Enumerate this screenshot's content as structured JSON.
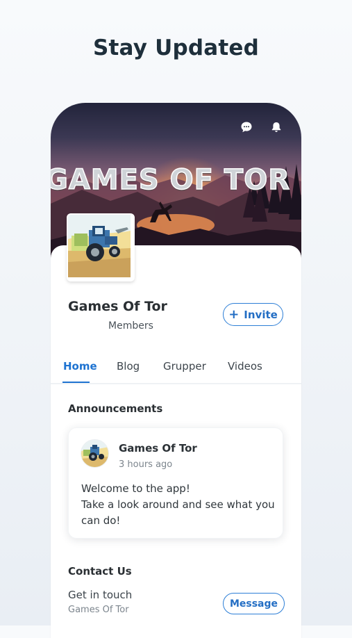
{
  "promo": {
    "headline": "Stay Updated"
  },
  "group": {
    "cover_title": "GAMES OF TOR",
    "name": "Games Of Tor",
    "members_label": "Members",
    "invite_label": "Invite"
  },
  "topbar": {
    "chat_icon": "chat-bubble-icon",
    "notifications_icon": "bell-icon"
  },
  "tabs": [
    {
      "label": "Home",
      "active": true
    },
    {
      "label": "Blog",
      "active": false
    },
    {
      "label": "Grupper",
      "active": false
    },
    {
      "label": "Videos",
      "active": false
    }
  ],
  "announcements": {
    "title": "Announcements",
    "post": {
      "author": "Games Of Tor",
      "time": "3 hours ago",
      "body": "Welcome to the app!\nTake a look around and see what you can do!"
    }
  },
  "contact": {
    "title": "Contact Us",
    "line": "Get in touch",
    "subline": "Games Of Tor",
    "button_label": "Message"
  },
  "colors": {
    "accent": "#1e73d1",
    "dark_text": "#2a2f33",
    "background": "#f3f6f9"
  }
}
